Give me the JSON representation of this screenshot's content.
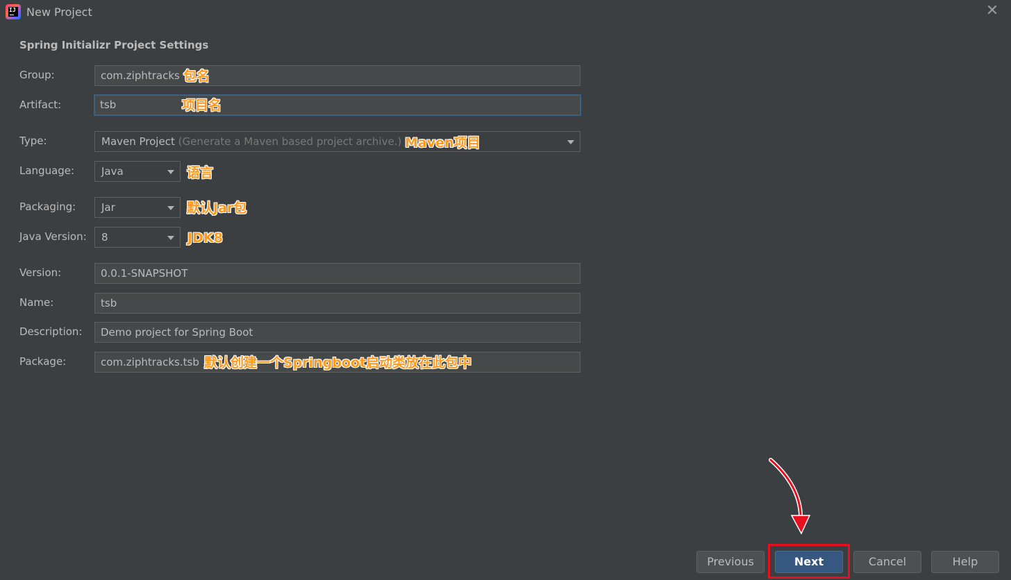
{
  "window": {
    "title": "New Project",
    "app_icon_text": "IJ"
  },
  "section_title": "Spring Initializr Project Settings",
  "fields": {
    "group": {
      "label": "Group:",
      "value": "com.ziphtracks",
      "annotation": "包名"
    },
    "artifact": {
      "label": "Artifact:",
      "value": "tsb",
      "annotation": "项目名"
    },
    "type": {
      "label": "Type:",
      "value": "Maven Project",
      "hint": "(Generate a Maven based project archive.)",
      "annotation": "Maven项目"
    },
    "language": {
      "label": "Language:",
      "value": "Java",
      "annotation": "语言"
    },
    "packaging": {
      "label": "Packaging:",
      "value": "Jar",
      "annotation": "默认Jar包"
    },
    "java_version": {
      "label": "Java Version:",
      "value": "8",
      "annotation": "JDK8"
    },
    "version": {
      "label": "Version:",
      "value": "0.0.1-SNAPSHOT"
    },
    "name": {
      "label": "Name:",
      "value": "tsb"
    },
    "description": {
      "label": "Description:",
      "value": "Demo project for Spring Boot"
    },
    "package": {
      "label": "Package:",
      "value": "com.ziphtracks.tsb",
      "annotation": "默认创建一个Springboot启动类放在此包中"
    }
  },
  "buttons": {
    "previous": "Previous",
    "next": "Next",
    "cancel": "Cancel",
    "help": "Help"
  },
  "colors": {
    "background": "#3c3f41",
    "annotation": "#ff9a1e",
    "highlight": "#e8101e",
    "primary_button": "#365880"
  }
}
